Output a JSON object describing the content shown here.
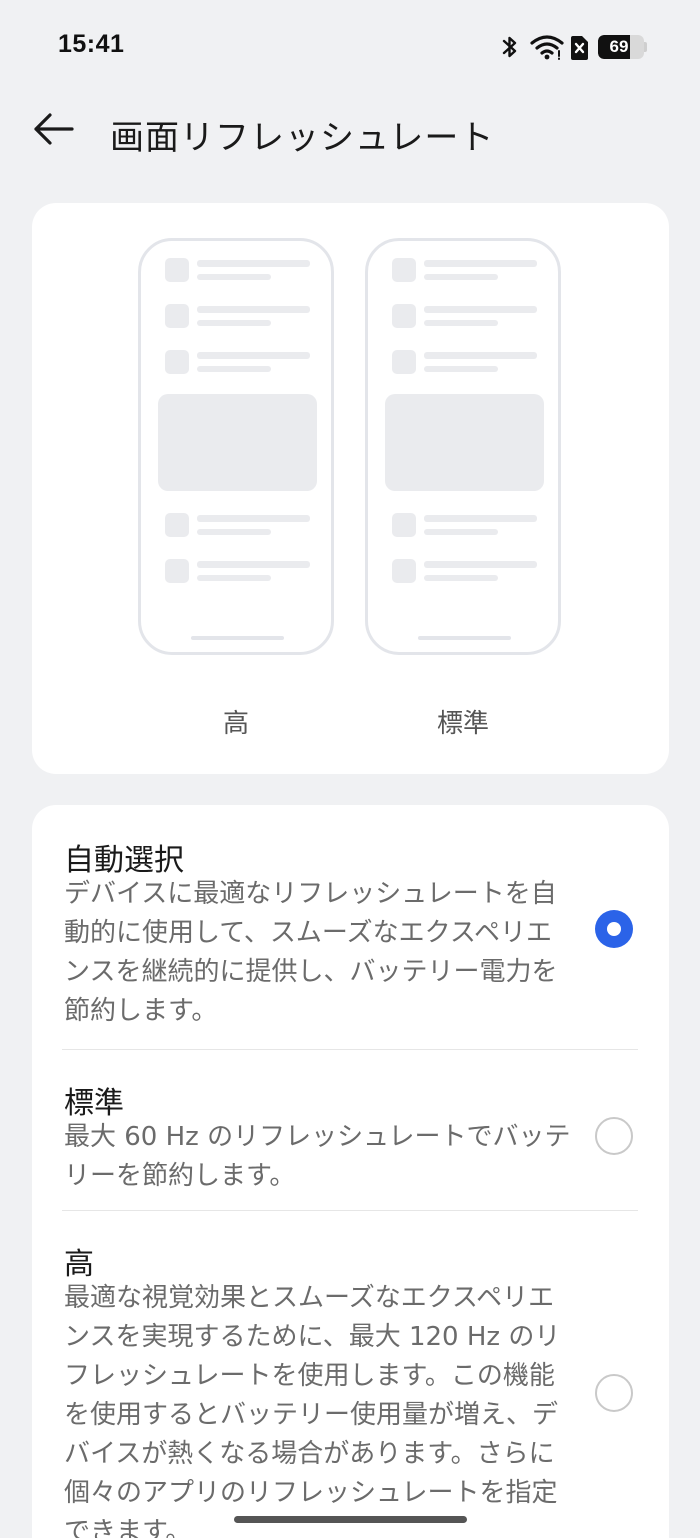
{
  "status_bar": {
    "time": "15:41",
    "battery_level": "69",
    "battery_fraction": 0.69,
    "icons": [
      "bluetooth-icon",
      "wifi-icon",
      "no-sim-icon",
      "battery-icon"
    ]
  },
  "header": {
    "back_icon": "arrow-left-icon",
    "title": "画面リフレッシュレート"
  },
  "preview": {
    "high_label": "高",
    "standard_label": "標準"
  },
  "options": [
    {
      "title": "自動選択",
      "description": "デバイスに最適なリフレッシュレートを自\n動的に使用して、スムーズなエクスペリエ\nンスを継続的に提供し、バッテリー電力を\n節約します。",
      "selected": true
    },
    {
      "title": "標準",
      "description": "最大 60 Hz のリフレッシュレートでバッテ\nリーを節約します。",
      "selected": false
    },
    {
      "title": "高",
      "description": "最適な視覚効果とスムーズなエクスペリエ\nンスを実現するために、最大 120 Hz のリ\nフレッシュレートを使用します。この機能\nを使用するとバッテリー使用量が増え、デ\nバイスが熱くなる場合があります。さらに\n個々のアプリのリフレッシュレートを指定\nできます。",
      "selected": false
    }
  ],
  "colors": {
    "accent": "#2b63e8",
    "background": "#f0f1f3",
    "card": "#ffffff"
  }
}
